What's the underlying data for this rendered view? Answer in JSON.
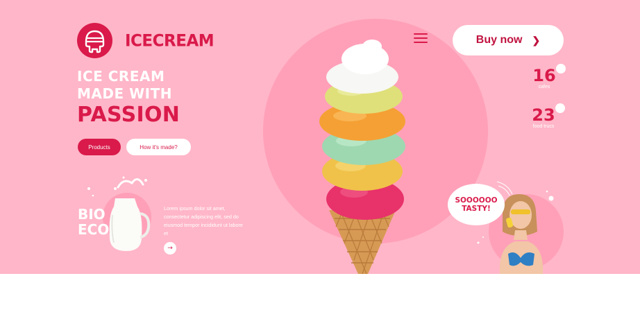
{
  "brand": {
    "name": "ICECREAM",
    "logo_icon": "ice-cream-face-logo"
  },
  "hero": {
    "line1": "ICE CREAM",
    "line2": "MADE WITH",
    "line3": "PASSION",
    "primary_button": "Products",
    "secondary_button": "How it's made?"
  },
  "nav": {
    "menu_icon": "hamburger-icon",
    "buy_label": "Buy now",
    "buy_icon": "chevron-right-icon"
  },
  "stats": [
    {
      "value": "16",
      "label": "cafes"
    },
    {
      "value": "23",
      "label": "food trucs"
    }
  ],
  "feature": {
    "bio_line1": "BIO",
    "bio_line2": "ECO",
    "description": "Lorem ipsum dolor sit amet, consectetur adipiscing elit, sed do eiusmod tempor incididunt ut labore et",
    "arrow_icon": "arrow-right-icon"
  },
  "bubble": {
    "line1": "SOOOOOO",
    "line2": "TASTY!"
  },
  "colors": {
    "background": "#ffb6c8",
    "accent": "#d91a4a",
    "circle": "#ffa0b8",
    "white": "#ffffff"
  }
}
